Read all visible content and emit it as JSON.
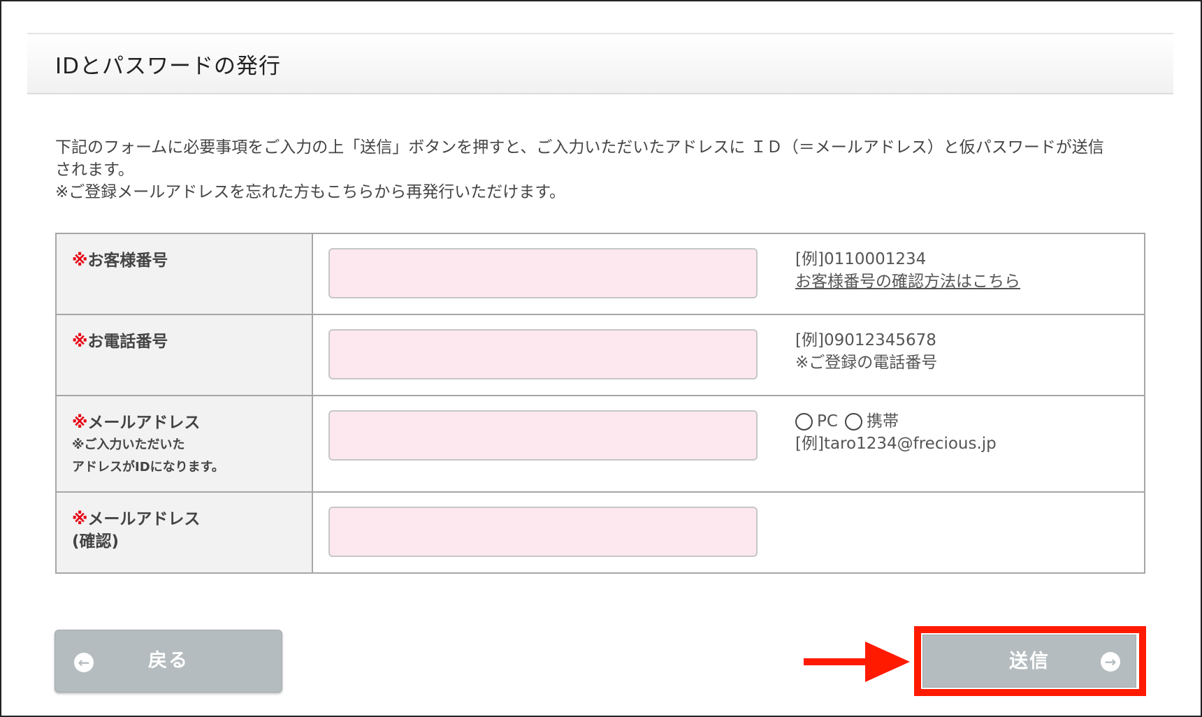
{
  "header": {
    "title": "IDとパスワードの発行"
  },
  "intro": {
    "line1": "下記のフォームに必要事項をご入力の上「送信」ボタンを押すと、ご入力いただいたアドレスに ＩＤ（＝メールアドレス）と仮パスワードが送信",
    "line2": "されます。",
    "line3": "※ご登録メールアドレスを忘れた方もこちらから再発行いただけます。"
  },
  "form": {
    "required_mark": "※",
    "rows": [
      {
        "label": "お客様番号",
        "value": "",
        "hint": "[例]0110001234",
        "link": "お客様番号の確認方法はこちら"
      },
      {
        "label": "お電話番号",
        "value": "",
        "hint": "[例]09012345678",
        "note": "※ご登録の電話番号"
      },
      {
        "label": "メールアドレス",
        "sub1": "※ご入力いただいた",
        "sub2": "アドレスがIDになります。",
        "value": "",
        "radio_pc": "PC",
        "radio_mobile": "携帯",
        "hint": "[例]taro1234@frecious.jp"
      },
      {
        "label": "メールアドレス",
        "sub1": "(確認)",
        "value": ""
      }
    ]
  },
  "buttons": {
    "back": "戻る",
    "submit": "送信",
    "back_icon": "arrow-left-circle-icon",
    "submit_icon": "arrow-right-circle-icon"
  },
  "colors": {
    "required": "#e60012",
    "input_bg": "#fde8ef",
    "button_bg": "#b4bcbf",
    "highlight": "#ff1a00"
  }
}
